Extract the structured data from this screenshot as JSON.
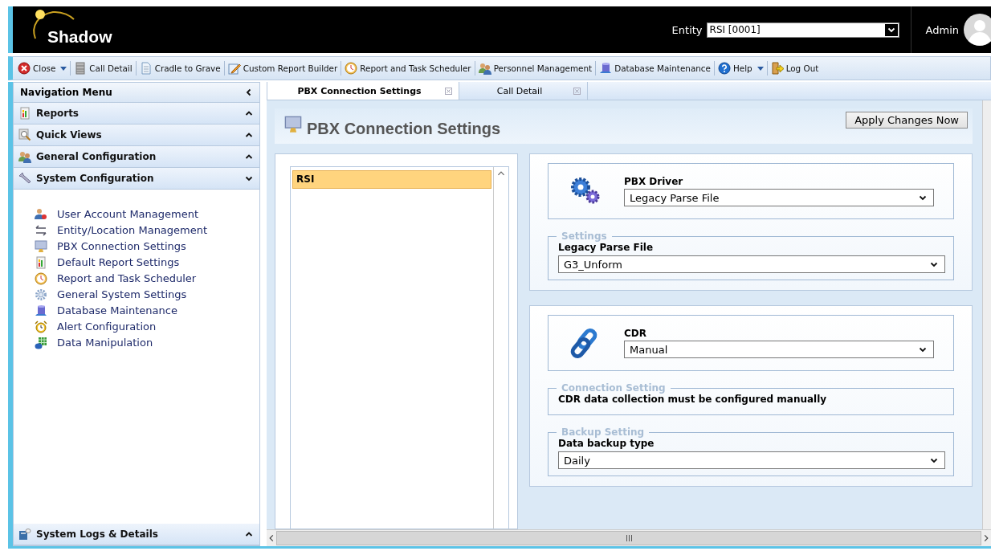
{
  "header": {
    "logo": "Shadow",
    "entity_label": "Entity",
    "entity_value": "RSI [0001]",
    "user": "Admin"
  },
  "toolbar": [
    {
      "label": "Close",
      "has_menu": true
    },
    {
      "label": "Call Detail",
      "has_menu": false
    },
    {
      "label": "Cradle to Grave",
      "has_menu": false
    },
    {
      "label": "Custom Report Builder",
      "has_menu": false
    },
    {
      "label": "Report and Task Scheduler",
      "has_menu": false
    },
    {
      "label": "Personnel Management",
      "has_menu": false
    },
    {
      "label": "Database Maintenance",
      "has_menu": false
    },
    {
      "label": "Help",
      "has_menu": true
    },
    {
      "label": "Log Out",
      "has_menu": false
    }
  ],
  "nav": {
    "title": "Navigation Menu",
    "sections": [
      {
        "label": "Reports",
        "expanded": false
      },
      {
        "label": "Quick Views",
        "expanded": false
      },
      {
        "label": "General Configuration",
        "expanded": false
      },
      {
        "label": "System Configuration",
        "expanded": true,
        "items": [
          "User Account Management",
          "Entity/Location Management",
          "PBX Connection Settings",
          "Default Report Settings",
          "Report and Task Scheduler",
          "General System Settings",
          "Database Maintenance",
          "Alert Configuration",
          "Data Manipulation"
        ]
      }
    ],
    "footer_section": {
      "label": "System Logs & Details",
      "expanded": false
    }
  },
  "tabs": [
    {
      "label": "PBX Connection Settings",
      "selected": true
    },
    {
      "label": "Call Detail",
      "selected": false
    }
  ],
  "page": {
    "title": "PBX Connection Settings",
    "apply_button": "Apply Changes Now",
    "locations": [
      {
        "label": "RSI",
        "selected": true
      }
    ],
    "cards": [
      {
        "label": "PBX Driver",
        "value": "Legacy Parse File",
        "fieldsets": [
          {
            "legend": "Settings",
            "kind": "select",
            "label": "Legacy Parse File",
            "value": "G3_Unform"
          }
        ]
      },
      {
        "label": "CDR",
        "value": "Manual",
        "fieldsets": [
          {
            "legend": "Connection Setting",
            "kind": "note",
            "text": "CDR data collection must be configured manually"
          },
          {
            "legend": "Backup Setting",
            "kind": "select",
            "label": "Data backup type",
            "value": "Daily"
          }
        ]
      }
    ]
  }
}
